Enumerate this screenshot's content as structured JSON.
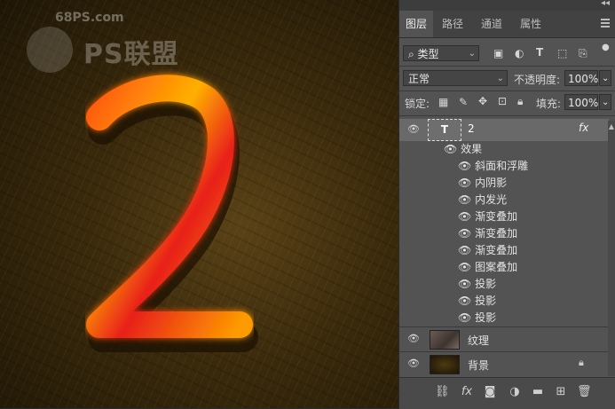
{
  "watermark": {
    "site": "68PS.com",
    "brand": "PS联盟"
  },
  "canvas": {
    "glyph": "2"
  },
  "panel": {
    "tabs": [
      {
        "label": "图层",
        "active": true
      },
      {
        "label": "路径",
        "active": false
      },
      {
        "label": "通道",
        "active": false
      },
      {
        "label": "属性",
        "active": false
      }
    ],
    "filter": {
      "kind": "类型"
    },
    "blend_mode": "正常",
    "opacity_label": "不透明度:",
    "opacity_value": "100%",
    "lock_label": "锁定:",
    "fill_label": "填充:",
    "fill_value": "100%",
    "layers": [
      {
        "name": "2",
        "type": "text",
        "thumb_glyph": "T",
        "fx_glyph": "fx",
        "effects_label": "效果",
        "effects": [
          "斜面和浮雕",
          "内阴影",
          "内发光",
          "渐变叠加",
          "渐变叠加",
          "渐变叠加",
          "图案叠加",
          "投影",
          "投影",
          "投影"
        ]
      },
      {
        "name": "纹理",
        "type": "image"
      },
      {
        "name": "背景",
        "type": "image",
        "locked": true
      }
    ]
  },
  "colors": {
    "panel_bg": "#535353",
    "selected_row": "#696969",
    "glow_orange": "#ff9a00",
    "glow_red": "#e0211a"
  }
}
